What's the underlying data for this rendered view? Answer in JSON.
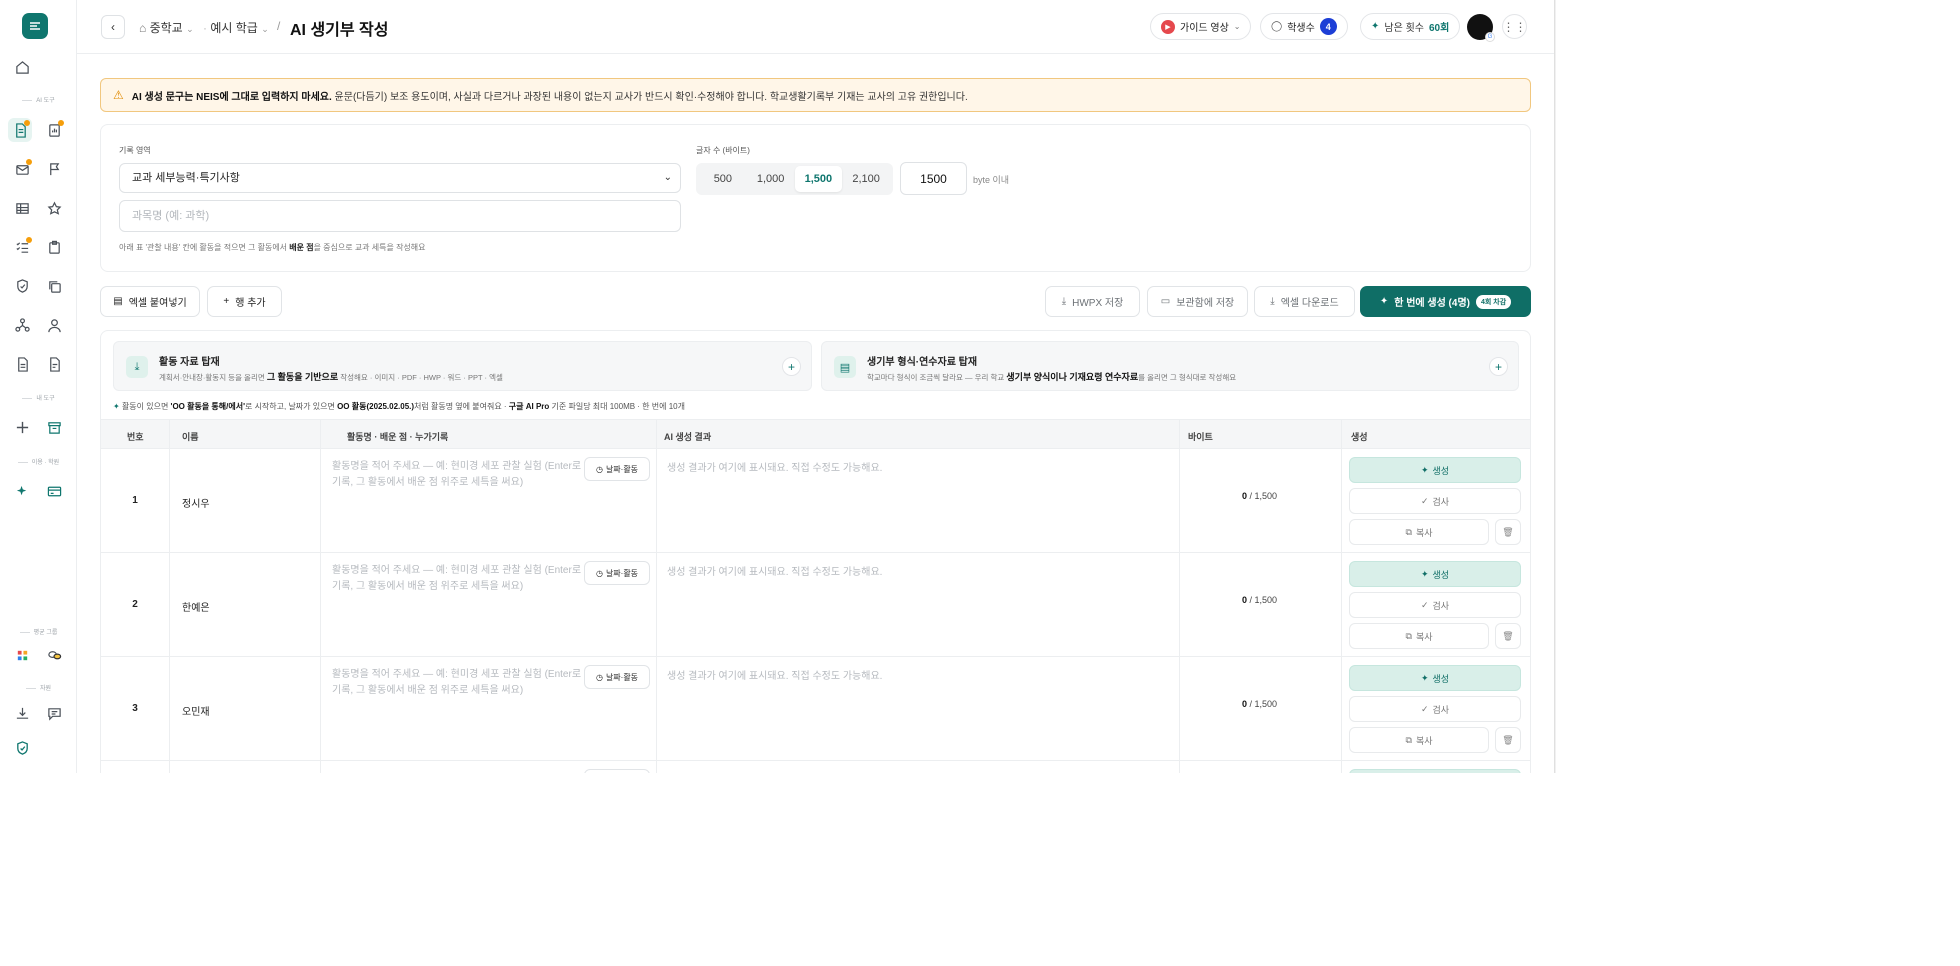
{
  "header": {
    "breadcrumb": [
      "중학교",
      "예시 학급"
    ],
    "title": "AI 생기부 작성",
    "guide_label": "가이드 영상",
    "students_label": "학생수",
    "students_count": "4",
    "remaining_label": "남은 횟수",
    "remaining_value": "60회"
  },
  "sidebar": {
    "labels": [
      "AI 도구",
      "내 도구",
      "이용 · 학원",
      "평균 그룹",
      "자원"
    ]
  },
  "warning": {
    "bold": "AI 생성 문구는 NEIS에 그대로 입력하지 마세요.",
    "text": "윤문(다듬기) 보조 용도이며, 사실과 다르거나 과장된 내용이 없는지 교사가 반드시 확인·수정해야 합니다. 학교생활기록부 기재는 교사의 고유 권한입니다."
  },
  "settings": {
    "area_label": "기록 영역",
    "area_value": "교과 세부능력·특기사항",
    "subject_placeholder": "과목명 (예: 과학)",
    "hint_pre": "아래 표 '관찰 내용' 칸에 활동을 적으면 그 활동에서 ",
    "hint_bold": "배운 점",
    "hint_post": "을 중심으로 교과 세특을 작성해요",
    "bytes_label": "글자 수 (바이트)",
    "byte_options": [
      "500",
      "1,000",
      "1,500",
      "2,100"
    ],
    "byte_selected": "1,500",
    "byte_input": "1500",
    "byte_suffix": "byte 이내"
  },
  "toolbar": {
    "paste_excel": "엑셀 붙여넣기",
    "add_row": "행 추가",
    "hwpx_save": "HWPX 저장",
    "archive_save": "보관함에 저장",
    "excel_download": "엑셀 다운로드",
    "generate_all": "한 번에 생성 (4명)",
    "generate_all_badge": "4회 차감"
  },
  "uploads": [
    {
      "title": "활동 자료 탑재",
      "sub_pre": "계획서·안내장·활동지 등을 올리면 ",
      "sub_bold": "그 활동을 기반으로",
      "sub_post": " 작성해요 · 이미지 · PDF · HWP · 워드 · PPT · 엑셀"
    },
    {
      "title": "생기부 형식·연수자료 탑재",
      "sub_pre": "학교마다 형식이 조금씩 달라요 — 우리 학교 ",
      "sub_bold": "생기부 양식이나 기재요령 연수자료",
      "sub_post": "를 올리면 그 형식대로 작성해요"
    }
  ],
  "tip": {
    "pre": "활동이 있으면 ",
    "b1": "'OO 활동을 통해/에서'",
    "mid": "로 시작하고, 날짜가 있으면 ",
    "b2": "OO 활동(2025.02.05.)",
    "mid2": "처럼 활동명 옆에 붙여줘요 · ",
    "b3": "구글 AI Pro",
    "post": " 기준 파일당 최대 100MB · 한 번에 10개"
  },
  "table": {
    "columns": [
      "번호",
      "이름",
      "활동명 · 배운 점 · 누가기록",
      "AI 생성 결과",
      "바이트",
      "생성"
    ],
    "activity_placeholder": "활동명을 적어 주세요 — 예: 현미경 세포 관찰 실험 (Enter로 기록, 그 활동에서 배운 점 위주로 세특을 써요)",
    "date_btn": "날짜·활동",
    "ai_placeholder": "생성 결과가 여기에 표시돼요. 직접 수정도 가능해요.",
    "byte_max": "/ 1,500",
    "generate": "생성",
    "check": "검사",
    "copy": "복사",
    "rows": [
      {
        "num": "1",
        "name": "정시우",
        "bytes": "0"
      },
      {
        "num": "2",
        "name": "한예은",
        "bytes": "0"
      },
      {
        "num": "3",
        "name": "오민재",
        "bytes": "0"
      },
      {
        "num": "",
        "name": "",
        "bytes": ""
      }
    ]
  },
  "colors": {
    "accent": "#0f6e66",
    "warning_bg": "#fff6e8",
    "badge": "#1d3fd6"
  }
}
